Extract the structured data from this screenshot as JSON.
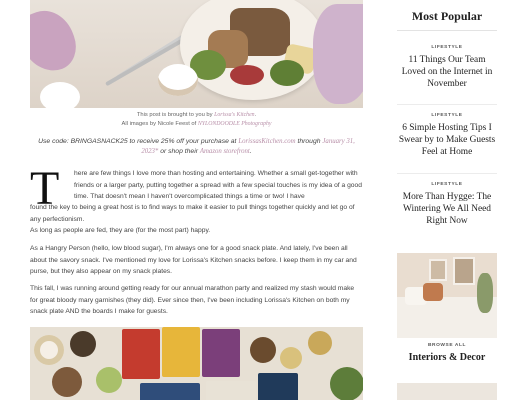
{
  "article": {
    "caption": {
      "line1_pre": "This post is brought to you by ",
      "line1_link": "Lorissa's Kitchen",
      "line1_post": ".",
      "line2_pre": "All images by Nicole Feest of ",
      "line2_link": "NYLONDOODLE Photography"
    },
    "promo": {
      "pre": "Use code: BRINGASNACK25 to receive 25% off your purchase at ",
      "link1": "LorissasKitchen.com",
      "mid": " through ",
      "link2": "January 31, 2023*",
      "mid2": " or shop their ",
      "link3": "Amazon storefront",
      "post": "."
    },
    "dropcap": "T",
    "para1_a": "here are few things I love more than hosting and entertaining. Whether a small get-together with friends or a larger party, putting together a spread with a few special touches is my idea of a good time. That doesn't mean I haven't overcomplicated things a time or two! I have",
    "para1_b": "found the key to being a great host is to find ways to make it easier to pull things together quickly and let go of any perfectionism.",
    "para2": "As long as people are fed, they are (for the most part) happy.",
    "para3": "As a Hangry Person (hello, low blood sugar), I'm always one for a good snack plate. And lately, I've been all about the savory snack. I've mentioned my love for Lorissa's Kitchen snacks before. I keep them in my car and purse, but they also appear on my snack plates.",
    "para4": "This fall, I was running around getting ready for our annual marathon party and realized my stash would make for great bloody mary garnishes (they did). Ever since then, I've been including Lorissa's Kitchen on both my snack plate AND the boards I make for guests."
  },
  "sidebar": {
    "title": "Most Popular",
    "posts": [
      {
        "tag": "LIFESTYLE",
        "title": "11 Things Our Team Loved on the Internet in November"
      },
      {
        "tag": "LIFESTYLE",
        "title": "6 Simple Hosting Tips I Swear by to Make Guests Feel at Home"
      },
      {
        "tag": "LIFESTYLE",
        "title": "More Than Hygge: The Wintering We All Need Right Now"
      }
    ],
    "browse_label": "BROWSE ALL",
    "browse_title": "Interiors & Decor"
  },
  "colors": {
    "link": "#b88fa8",
    "text": "#444444",
    "heading": "#222222"
  }
}
